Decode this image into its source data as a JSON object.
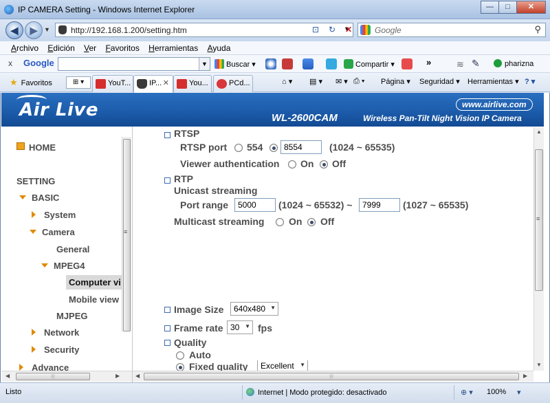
{
  "window": {
    "title": "IP CAMERA Setting - Windows Internet Explorer",
    "minimize": "—",
    "maximize": "□",
    "close": "✕"
  },
  "address": {
    "url": "http://192.168.1.200/setting.htm",
    "search_placeholder": "Google"
  },
  "menu": [
    "Archivo",
    "Edición",
    "Ver",
    "Favoritos",
    "Herramientas",
    "Ayuda"
  ],
  "google_toolbar": {
    "close": "x",
    "logo": "Google",
    "buscar": "Buscar",
    "compartir": "Compartir",
    "more": "»",
    "user": "pharizna"
  },
  "favorites": {
    "label": "Favoritos",
    "tabs": [
      {
        "label": "YouT...",
        "icon": "youtube-icon"
      },
      {
        "label": "IP...",
        "icon": "camera-page-icon",
        "close": "✕"
      },
      {
        "label": "You...",
        "icon": "youtube-icon"
      },
      {
        "label": "PCd...",
        "icon": "pcd-icon"
      }
    ],
    "commands": {
      "pagina": "Página",
      "seguridad": "Seguridad",
      "herramientas": "Herramientas"
    }
  },
  "banner": {
    "logo": "Air Live",
    "website": "www.airlive.com",
    "model": "WL-2600CAM",
    "tagline": "Wireless Pan-Tilt Night Vision IP Camera"
  },
  "nav": {
    "home": "HOME",
    "setting": "SETTING",
    "basic": "BASIC",
    "system": "System",
    "camera": "Camera",
    "general": "General",
    "mpeg4": "MPEG4",
    "computer_view": "Computer vi",
    "mobile_view": "Mobile view",
    "mjpeg": "MJPEG",
    "network": "Network",
    "security": "Security",
    "advance": "Advance"
  },
  "form": {
    "rtsp": {
      "title": "RTSP",
      "port_label": "RTSP port",
      "port_default": "554",
      "port_value": "8554",
      "port_range": "(1024 ~ 65535)",
      "viewer_auth_label": "Viewer authentication",
      "on": "On",
      "off": "Off"
    },
    "rtp": {
      "title": "RTP",
      "unicast_label": "Unicast streaming",
      "port_range_label": "Port range",
      "port_from": "5000",
      "range_from": "(1024 ~ 65532) ~",
      "port_to": "7999",
      "range_to": "(1027 ~ 65535)",
      "multicast_label": "Multicast streaming",
      "on": "On",
      "off": "Off"
    },
    "image_size": {
      "label": "Image Size",
      "value": "640x480"
    },
    "frame_rate": {
      "label": "Frame rate",
      "value": "30",
      "unit": "fps"
    },
    "quality": {
      "label": "Quality",
      "auto": "Auto",
      "fixed": "Fixed quality",
      "fixed_value": "Excellent"
    }
  },
  "statusbar": {
    "status": "Listo",
    "zone": "Internet | Modo protegido: desactivado",
    "zoom": "100%"
  }
}
